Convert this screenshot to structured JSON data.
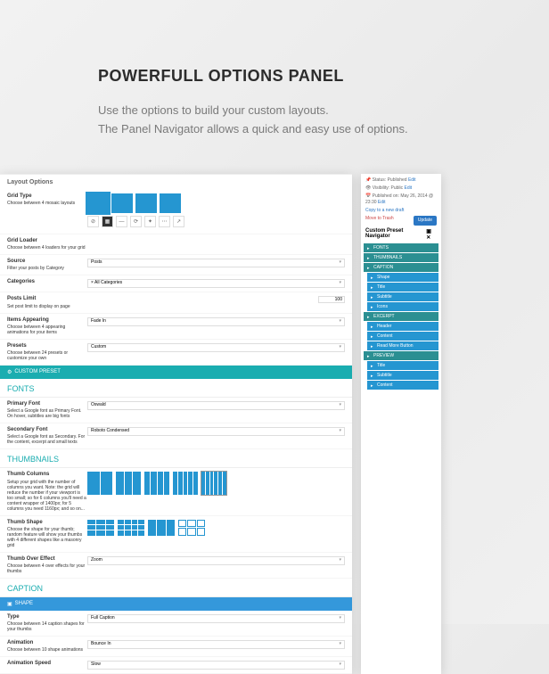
{
  "header": {
    "title": "POWERFULL OPTIONS PANEL",
    "line1": "Use the options to build your custom layouts.",
    "line2": "The Panel Navigator allows a quick and easy use of options."
  },
  "left": {
    "layout_options": "Layout Options",
    "grid_type": {
      "label": "Grid Type",
      "desc": "Choose between 4 mosaic layouts"
    },
    "grid_loader": {
      "label": "Grid Loader",
      "desc": "Choose between 4 loaders for your grid"
    },
    "source": {
      "label": "Source",
      "desc": "Filter your posts by Category",
      "value": "Posts"
    },
    "categories": {
      "label": "Categories",
      "value": "× All Categories"
    },
    "posts_limit": {
      "label": "Posts Limit",
      "desc": "Set post limit to display on page",
      "value": "100"
    },
    "items_appearing": {
      "label": "Items Appearing",
      "desc": "Choose between 4 appearing animations for your items",
      "value": "Fade In"
    },
    "presets": {
      "label": "Presets",
      "desc": "Choose between 24 presets or customize your own",
      "value": "Custom"
    },
    "custom_preset": "CUSTOM PRESET",
    "fonts": "FONTS",
    "primary_font": {
      "label": "Primary Font",
      "desc": "Select a Google font as Primary Font. On hover, subtitles are big fonts",
      "value": "Oswald"
    },
    "secondary_font": {
      "label": "Secondary Font",
      "desc": "Select a Google font as Secondary. For the content, excerpt and small texts",
      "value": "Roboto Condensed"
    },
    "thumbnails": "THUMBNAILS",
    "thumb_cols": {
      "label": "Thumb Columns",
      "desc": "Setup your grid with the number of columns you want. Note: the grid will reduce the number if your viewport is too small; so for 6 columns you'll need a content wrapper of 1400px; for 5 columns you need 1160px; and so on..."
    },
    "thumb_shape": {
      "label": "Thumb Shape",
      "desc": "Choose the shape for your thumb; random feature will show your thumbs with 4 different shapes like a masonry grid"
    },
    "thumb_over": {
      "label": "Thumb Over Effect",
      "desc": "Choose between 4 over effects for your thumbs",
      "value": "Zoom"
    },
    "caption": "CAPTION",
    "shape": "SHAPE",
    "type": {
      "label": "Type",
      "desc": "Choose between 14 caption shapes for your thumbs",
      "value": "Full Caption"
    },
    "animation": {
      "label": "Animation",
      "desc": "Choose between 10 shape animations",
      "value": "Bounce In"
    },
    "anim_speed": {
      "label": "Animation Speed",
      "value": "Slow"
    }
  },
  "right": {
    "status": "Status: Published",
    "edit1": "Edit",
    "visibility": "Visibility: Public",
    "edit2": "Edit",
    "published": "Published on: May 26, 2014 @ 23:30",
    "edit3": "Edit",
    "copy": "Copy to a new draft",
    "trash": "Move to Trash",
    "update": "Update",
    "nav_title": "Custom Preset Navigator",
    "items": [
      {
        "t": "FONTS",
        "cls": "rp-item"
      },
      {
        "t": "THUMBNAILS",
        "cls": "rp-item"
      },
      {
        "t": "CAPTION",
        "cls": "rp-item"
      },
      {
        "t": "Shape",
        "cls": "rp-item rp-sub"
      },
      {
        "t": "Title",
        "cls": "rp-item rp-sub"
      },
      {
        "t": "Subtitle",
        "cls": "rp-item rp-sub"
      },
      {
        "t": "Icons",
        "cls": "rp-item rp-sub"
      },
      {
        "t": "EXCERPT",
        "cls": "rp-item"
      },
      {
        "t": "Header",
        "cls": "rp-item rp-sub"
      },
      {
        "t": "Content",
        "cls": "rp-item rp-sub"
      },
      {
        "t": "Read More Button",
        "cls": "rp-item rp-sub"
      },
      {
        "t": "PREVIEW",
        "cls": "rp-item"
      },
      {
        "t": "Title",
        "cls": "rp-item rp-sub"
      },
      {
        "t": "Subtitle",
        "cls": "rp-item rp-sub"
      },
      {
        "t": "Content",
        "cls": "rp-item rp-sub"
      }
    ]
  }
}
